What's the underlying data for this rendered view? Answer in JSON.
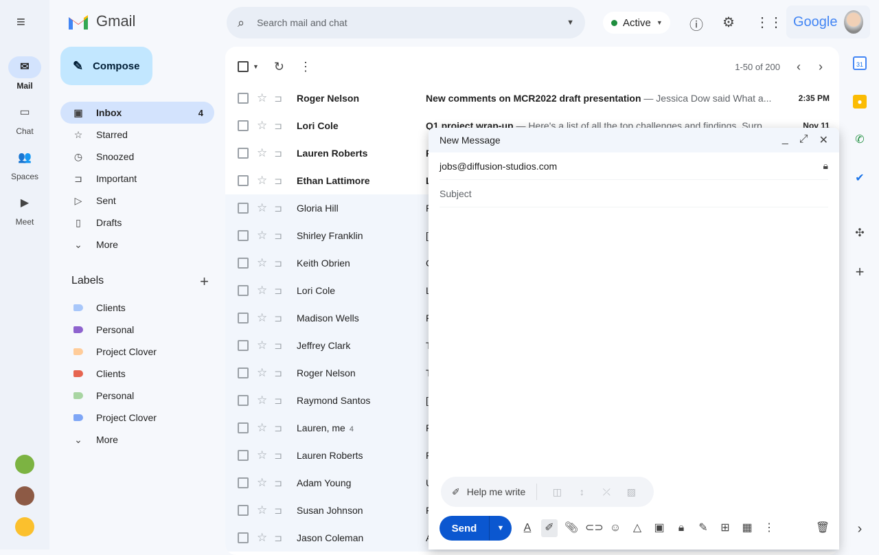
{
  "rail": {
    "items": [
      {
        "label": "Mail",
        "icon": "mail-icon"
      },
      {
        "label": "Chat",
        "icon": "chat-icon"
      },
      {
        "label": "Spaces",
        "icon": "spaces-icon"
      },
      {
        "label": "Meet",
        "icon": "video-icon"
      }
    ]
  },
  "app": {
    "name": "Gmail"
  },
  "compose_label": "Compose",
  "nav": [
    {
      "label": "Inbox",
      "count": "4"
    },
    {
      "label": "Starred"
    },
    {
      "label": "Snoozed"
    },
    {
      "label": "Important"
    },
    {
      "label": "Sent"
    },
    {
      "label": "Drafts"
    },
    {
      "label": "More"
    }
  ],
  "labels": {
    "title": "Labels",
    "items": [
      {
        "label": "Clients",
        "color": "#a8c7fa"
      },
      {
        "label": "Personal",
        "color": "#8e63ce"
      },
      {
        "label": "Project Clover",
        "color": "#ffcc99"
      },
      {
        "label": "Clients",
        "color": "#e66550"
      },
      {
        "label": "Personal",
        "color": "#a8d5a2"
      },
      {
        "label": "Project Clover",
        "color": "#7ea6f6"
      }
    ],
    "more": "More"
  },
  "search": {
    "placeholder": "Search mail and chat"
  },
  "status": {
    "label": "Active"
  },
  "brand": "Google",
  "pagination": "1-50 of 200",
  "emails": [
    {
      "sender": "Roger Nelson",
      "subject": "New comments on MCR2022 draft presentation",
      "snippet": " — Jessica Dow said What a...",
      "date": "2:35 PM",
      "unread": true
    },
    {
      "sender": "Lori Cole",
      "subject": "Q1 project wrap-up",
      "snippet": " — Here's a list of all the top challenges and findings. Surp...",
      "date": "Nov 11",
      "unread": true
    },
    {
      "sender": "Lauren Roberts",
      "subject": "F",
      "snippet": "",
      "date": "",
      "unread": true
    },
    {
      "sender": "Ethan Lattimore",
      "subject": "L",
      "snippet": "",
      "date": "",
      "unread": true
    },
    {
      "sender": "Gloria Hill",
      "subject": "F",
      "unread": false
    },
    {
      "sender": "Shirley Franklin",
      "subject": "[",
      "unread": false
    },
    {
      "sender": "Keith Obrien",
      "subject": "C",
      "unread": false
    },
    {
      "sender": "Lori Cole",
      "subject": "L",
      "unread": false
    },
    {
      "sender": "Madison Wells",
      "subject": "F",
      "unread": false
    },
    {
      "sender": "Jeffrey Clark",
      "subject": "T",
      "unread": false
    },
    {
      "sender": "Roger Nelson",
      "subject": "T",
      "unread": false
    },
    {
      "sender": "Raymond Santos",
      "subject": "[",
      "unread": false
    },
    {
      "sender": "Lauren, me",
      "count": "4",
      "subject": "F",
      "unread": false
    },
    {
      "sender": "Lauren Roberts",
      "subject": "F",
      "unread": false
    },
    {
      "sender": "Adam Young",
      "subject": "U",
      "unread": false
    },
    {
      "sender": "Susan Johnson",
      "subject": "F",
      "unread": false
    },
    {
      "sender": "Jason Coleman",
      "subject": "A",
      "unread": false
    }
  ],
  "compose_window": {
    "title": "New Message",
    "to": "jobs@diffusion-studios.com",
    "subject_placeholder": "Subject",
    "help_me_write": "Help me write",
    "send": "Send"
  }
}
